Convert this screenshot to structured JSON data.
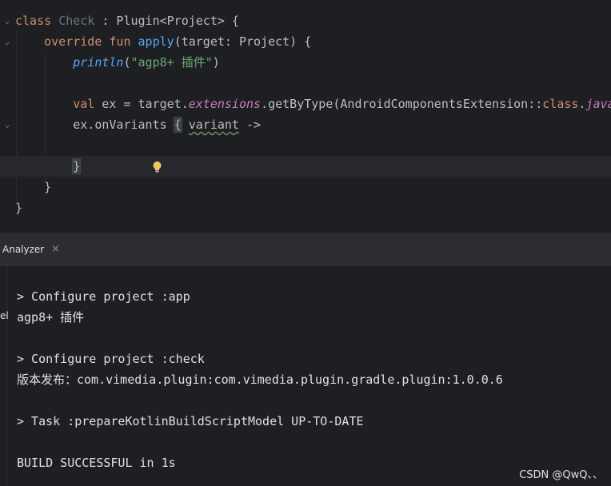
{
  "editor": {
    "lines": {
      "l1": {
        "kw": "class",
        "name": "Check",
        "rest": " : Plugin<Project> {"
      },
      "l2": {
        "kw_override": "override",
        "kw_fun": "fun",
        "fn": "apply",
        "rest": "(target: Project) {"
      },
      "l3": {
        "fn": "println",
        "open": "(",
        "str": "\"agp8+ 插件\"",
        "close": ")"
      },
      "l5": {
        "kw": "val",
        "mid": " ex = target.",
        "ext": "extensions",
        "after": ".getByType(AndroidComponentsExtension::",
        "kw2": "class",
        "dot": ".",
        "ext2": "java"
      },
      "l6": {
        "pre": "ex.onVariants ",
        "brace": "{",
        "space": " ",
        "param": "variant",
        "arrow": " ->"
      },
      "l8": {
        "brace": "}"
      },
      "l9": {
        "text": "}"
      },
      "l10": {
        "text": "}"
      }
    },
    "icons": {
      "fold": "chevron-down-icon",
      "bulb": "lightbulb-icon"
    }
  },
  "panel": {
    "tab_label": "Analyzer",
    "tab_close": "×",
    "edge_text": "el"
  },
  "output": {
    "lines": [
      "> Configure project :app",
      "agp8+ 插件",
      "",
      "> Configure project :check",
      "版本发布：com.vimedia.plugin:com.vimedia.plugin.gradle.plugin:1.0.0.6",
      "",
      "> Task :prepareKotlinBuildScriptModel UP-TO-DATE",
      "",
      "BUILD SUCCESSFUL in 1s"
    ]
  },
  "watermark": "CSDN @QwQ、、",
  "colors": {
    "background": "#1e1f22",
    "keyword": "#cf8e6d",
    "function": "#56a8f5",
    "string": "#6aab73",
    "extension": "#c77dbb"
  }
}
